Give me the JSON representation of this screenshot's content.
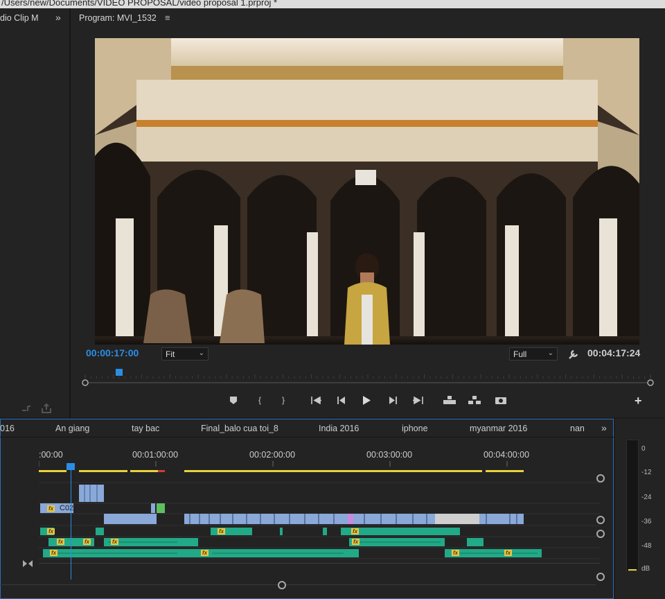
{
  "window": {
    "title": "/Users/new/Documents/VIDEO PROPOSAL/video proposal 1.prproj *"
  },
  "left_panel": {
    "title": "dio Clip M",
    "expand_glyph": "»"
  },
  "program": {
    "title": "Program: MVI_1532",
    "menu_glyph": "≡",
    "current_timecode": "00:00:17:00",
    "fit_value": "Fit",
    "resolution_value": "Full",
    "duration_timecode": "00:04:17:24",
    "playhead_fraction": 0.06
  },
  "transport": {
    "marker": "marker-icon",
    "in": "{",
    "out": "}",
    "go_in": "go-to-in-icon",
    "step_back": "step-back-icon",
    "play": "play-icon",
    "step_fwd": "step-forward-icon",
    "go_out": "go-to-out-icon",
    "lift": "lift-icon",
    "extract": "extract-icon",
    "export_frame": "camera-icon",
    "add": "+"
  },
  "sequence": {
    "tabs": [
      "016",
      "An giang",
      "tay bac",
      "Final_balo cua toi_8",
      "India 2016",
      "iphone",
      "myanmar 2016",
      "nan"
    ],
    "more_glyph": "»",
    "ruler_labels": [
      ":00:00",
      "00:01:00:00",
      "00:02:00:00",
      "00:03:00:00",
      "00:04:00:00"
    ],
    "clip_name": "C02"
  },
  "meter": {
    "scale": [
      "0",
      "-12",
      "-24",
      "-36",
      "-48",
      "dB"
    ]
  },
  "colors": {
    "accent": "#2b8ee6",
    "clip_blue": "#8aa8d8",
    "clip_green": "#22a987",
    "fx_yellow": "#e8c84a"
  }
}
